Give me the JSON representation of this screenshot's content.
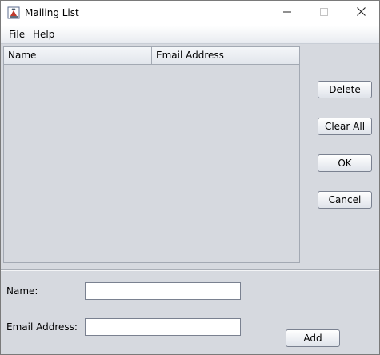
{
  "window": {
    "title": "Mailing List",
    "icons": {
      "app": "java-cup-icon",
      "minimize": "minimize-icon",
      "maximize": "maximize-icon",
      "close": "close-icon"
    }
  },
  "menubar": {
    "items": [
      {
        "label": "File"
      },
      {
        "label": "Help"
      }
    ]
  },
  "table": {
    "columns": [
      {
        "label": "Name"
      },
      {
        "label": "Email Address"
      }
    ],
    "rows": []
  },
  "buttons": {
    "delete": "Delete",
    "clear_all": "Clear All",
    "ok": "OK",
    "cancel": "Cancel",
    "add": "Add"
  },
  "form": {
    "name_label": "Name:",
    "name_value": "",
    "email_label": "Email Address:",
    "email_value": ""
  }
}
